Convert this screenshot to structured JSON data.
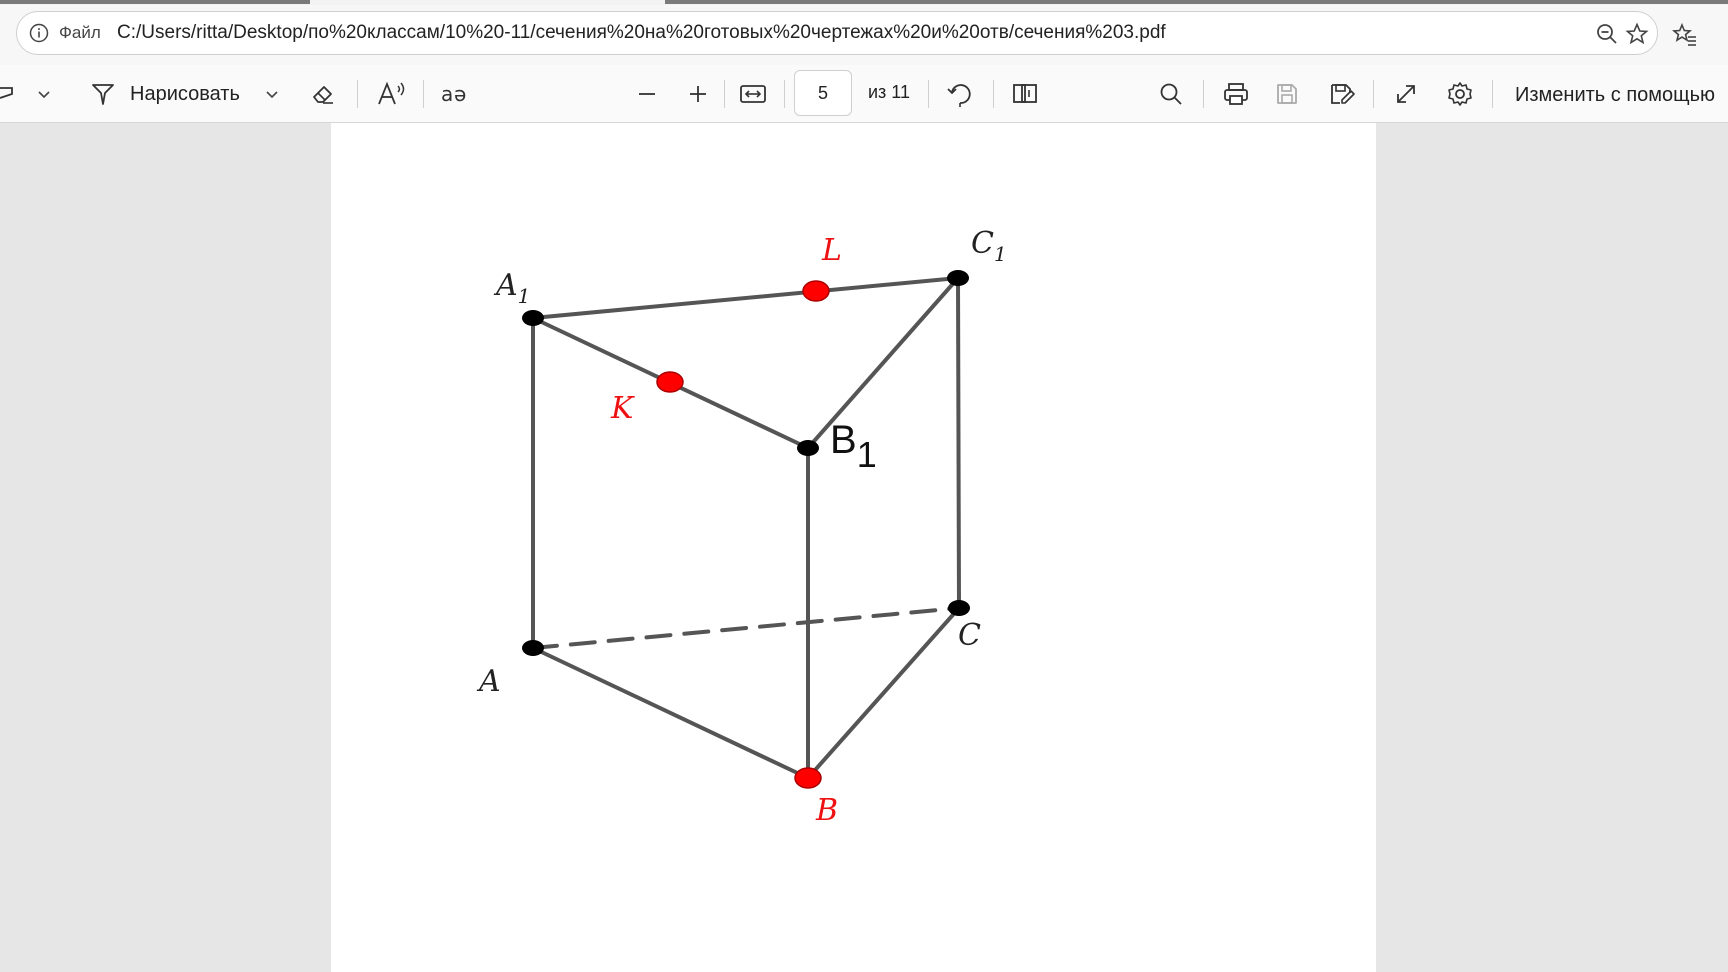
{
  "address": {
    "scheme": "Файл",
    "url": "C:/Users/ritta/Desktop/по%20классам/10%20-11/сечения%20на%20готовых%20чертежах%20и%20отв/сечения%203.pdf"
  },
  "toolbar": {
    "draw_label": "Нарисовать",
    "page_current": "5",
    "page_total": "из 11",
    "edit_with_label": "Изменить с помощью"
  },
  "figure": {
    "labels": {
      "A": "A",
      "B": "B",
      "C": "C",
      "A1": "A",
      "A1_sub": "1",
      "B1": "B",
      "B1_sub": "1",
      "C1": "C",
      "C1_sub": "1",
      "K": "K",
      "L": "L"
    },
    "colors": {
      "edge": "#555555",
      "vertex": "#000000",
      "marked_point": "#ff0000"
    },
    "marked_points": [
      "K",
      "L",
      "B"
    ]
  }
}
